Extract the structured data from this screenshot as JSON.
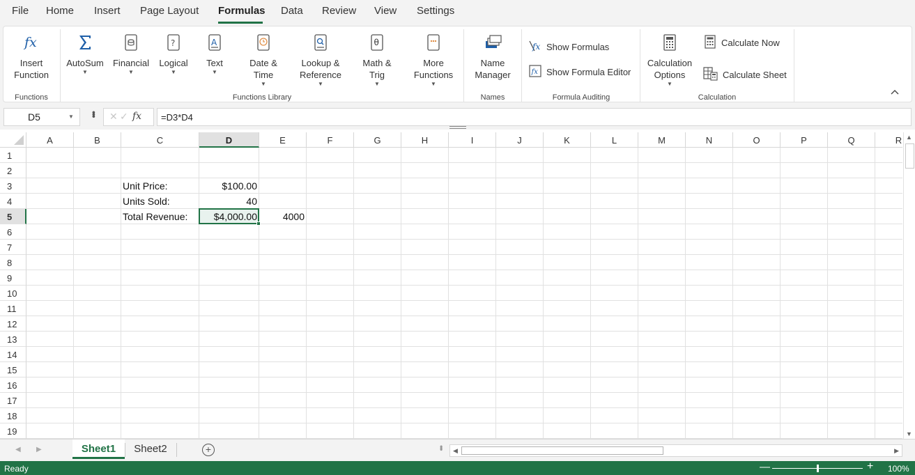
{
  "menu": {
    "items": [
      "File",
      "Home",
      "Insert",
      "Page Layout",
      "Formulas",
      "Data",
      "Review",
      "View",
      "Settings"
    ],
    "active": "Formulas"
  },
  "ribbon": {
    "insert_function": {
      "line1": "Insert",
      "line2": "Function"
    },
    "autosum": "AutoSum",
    "financial": "Financial",
    "logical": "Logical",
    "text": "Text",
    "datetime": {
      "line1": "Date &",
      "line2": "Time"
    },
    "lookup": {
      "line1": "Lookup &",
      "line2": "Reference"
    },
    "mathtrig": {
      "line1": "Math &",
      "line2": "Trig"
    },
    "more": {
      "line1": "More",
      "line2": "Functions"
    },
    "name_manager": {
      "line1": "Name",
      "line2": "Manager"
    },
    "show_formulas": "Show Formulas",
    "show_formula_editor": "Show Formula Editor",
    "calc_options": {
      "line1": "Calculation",
      "line2": "Options"
    },
    "calc_now": "Calculate Now",
    "calc_sheet": "Calculate Sheet",
    "groups": {
      "functions": "Functions",
      "library": "Functions Library",
      "names": "Names",
      "auditing": "Formula Auditing",
      "calculation": "Calculation"
    }
  },
  "formula_bar": {
    "name_box": "D5",
    "formula": "=D3*D4"
  },
  "columns": [
    "A",
    "B",
    "C",
    "D",
    "E",
    "F",
    "G",
    "H",
    "I",
    "J",
    "K",
    "L",
    "M",
    "N",
    "O",
    "P",
    "Q",
    "R"
  ],
  "rows": [
    "1",
    "2",
    "3",
    "4",
    "5",
    "6",
    "7",
    "8",
    "9",
    "10",
    "11",
    "12",
    "13",
    "14",
    "15",
    "16",
    "17",
    "18",
    "19"
  ],
  "selected_column": "D",
  "selected_row": "5",
  "cells": {
    "C3": "Unit Price:",
    "D3": "$100.00",
    "C4": "Units Sold:",
    "D4": "40",
    "C5": "Total Revenue:",
    "D5": "$4,000.00",
    "E5": "4000"
  },
  "sheets": {
    "tabs": [
      "Sheet1",
      "Sheet2"
    ],
    "active": "Sheet1"
  },
  "status": {
    "text": "Ready",
    "zoom": "100%",
    "zoom_fraction": 0.5
  },
  "colors": {
    "accent": "#217346",
    "icon_blue": "#1f5fa8",
    "icon_gray": "#555555",
    "icon_orange": "#e0904a"
  }
}
